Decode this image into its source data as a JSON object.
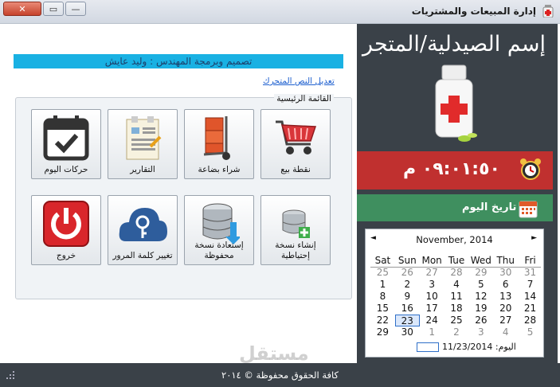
{
  "window": {
    "title": "إدارة المبيعات والمشتريات",
    "close_label": "✕",
    "maximize_label": "▭",
    "minimize_label": "—"
  },
  "header": {
    "store_name": "إسم الصيدلية/المتجر",
    "banner_text": "تصميم وبرمجة المهندس : وليد عايش",
    "edit_link": "تعديل النص المتحرك"
  },
  "clock": {
    "time_text": "٠٩:٠١:٥٠ م"
  },
  "today_label": "تاريخ اليوم",
  "main_menu": {
    "legend": "القائمة الرئيسية",
    "items": [
      {
        "label": "نقطة بيع",
        "icon": "cart-icon"
      },
      {
        "label": "شراء بضاعة",
        "icon": "hand-truck-icon"
      },
      {
        "label": "التقارير",
        "icon": "report-icon"
      },
      {
        "label": "حركات اليوم",
        "icon": "calendar-check-icon"
      },
      {
        "label": "إنشاء نسخة إحتياطية",
        "icon": "database-add-icon"
      },
      {
        "label": "إستعادة نسخة محفوظة",
        "icon": "database-restore-icon"
      },
      {
        "label": "تغيير كلمة المرور",
        "icon": "key-cloud-icon"
      },
      {
        "label": "خروج",
        "icon": "power-icon"
      }
    ]
  },
  "calendar": {
    "month_label": "November, 2014",
    "prev": "◄",
    "next": "►",
    "day_names": [
      "Sat",
      "Sun",
      "Mon",
      "Tue",
      "Wed",
      "Thu",
      "Fri"
    ],
    "weeks": [
      [
        "25",
        "26",
        "27",
        "28",
        "29",
        "30",
        "31"
      ],
      [
        "1",
        "2",
        "3",
        "4",
        "5",
        "6",
        "7"
      ],
      [
        "8",
        "9",
        "10",
        "11",
        "12",
        "13",
        "14"
      ],
      [
        "15",
        "16",
        "17",
        "18",
        "19",
        "20",
        "21"
      ],
      [
        "22",
        "23",
        "24",
        "25",
        "26",
        "27",
        "28"
      ],
      [
        "29",
        "30",
        "1",
        "2",
        "3",
        "4",
        "5"
      ]
    ],
    "today_text": "اليوم: 11/23/2014",
    "selected_day": "23"
  },
  "footer": {
    "text": "كافة الحقوق محفوظة © ٢٠١٤"
  },
  "watermark": "مستقل"
}
